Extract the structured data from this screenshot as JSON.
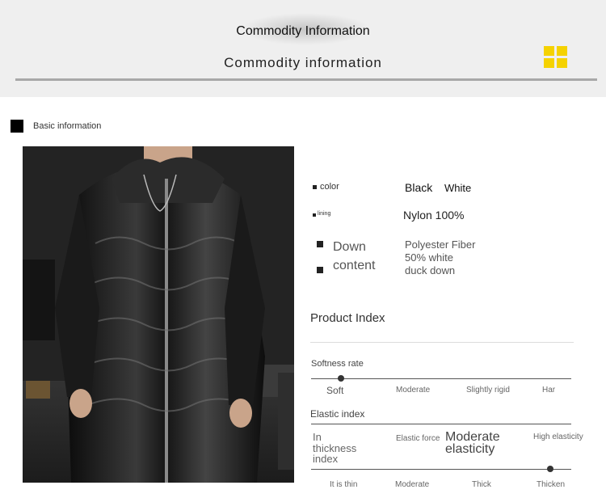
{
  "header": {
    "title": "Commodity Information",
    "subtitle": "Commodity information"
  },
  "section": {
    "label": "Basic information"
  },
  "attributes": {
    "color_label": "color",
    "color_values": [
      "Black",
      "White"
    ],
    "lining_label": "lining",
    "lining_value": "Nylon 100%",
    "down_label_1": "Down",
    "down_label_2": "content",
    "down_value_1": "Polyester Fiber",
    "down_value_2": "50% white",
    "down_value_3": "duck down"
  },
  "product_index": {
    "title": "Product Index",
    "softness": {
      "label": "Softness rate",
      "options": [
        "Soft",
        "Moderate",
        "Slightly rigid",
        "Har"
      ],
      "selected": "Soft"
    },
    "elastic": {
      "label": "Elastic index",
      "options": [
        "Elastic force",
        "Moderate elasticity",
        "High elasticity"
      ],
      "selected": "Moderate elasticity"
    },
    "thickness": {
      "label_1": "In",
      "label_2": "thickness",
      "label_3": "index",
      "options": [
        "It is thin",
        "Moderate",
        "Thick",
        "Thicken"
      ],
      "selected": "Thicken"
    }
  },
  "colors": {
    "accent": "#f5d200",
    "header_bg": "#efefef",
    "rule": "#a8a8a8"
  }
}
